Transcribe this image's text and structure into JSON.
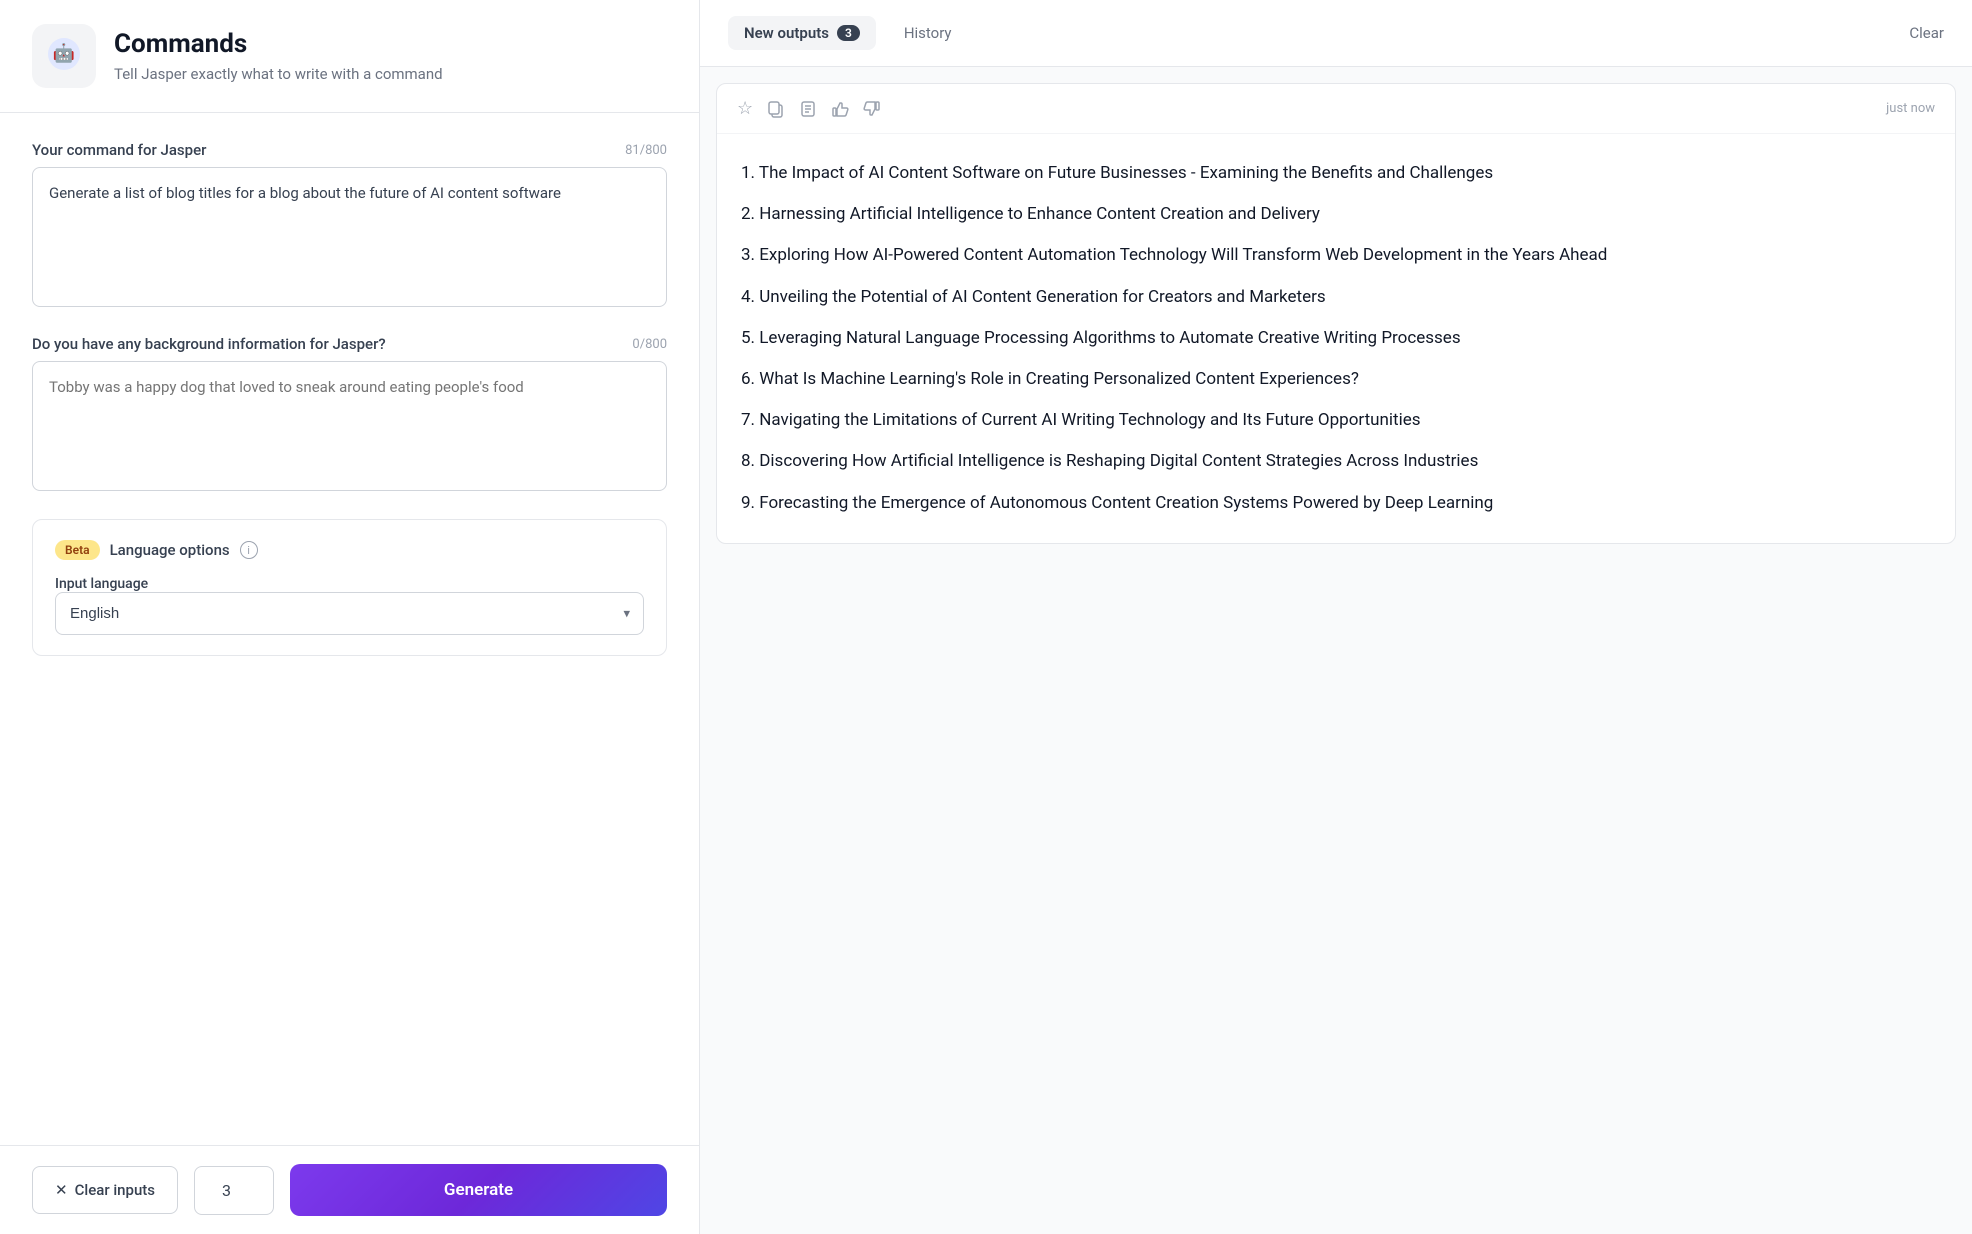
{
  "header": {
    "title": "Commands",
    "subtitle": "Tell Jasper exactly what to write with a command",
    "icon_label": "commands-icon"
  },
  "command_field": {
    "label": "Your command for Jasper",
    "char_count": "81/800",
    "value": "Generate a list of blog titles for a blog about the future of AI content software",
    "placeholder": ""
  },
  "background_field": {
    "label": "Do you have any background information for Jasper?",
    "char_count": "0/800",
    "value": "",
    "placeholder": "Tobby was a happy dog that loved to sneak around eating people's food"
  },
  "language_section": {
    "beta_label": "Beta",
    "title": "Language options",
    "input_lang_label": "Input language",
    "selected_language": "English"
  },
  "bottom_bar": {
    "clear_label": "Clear inputs",
    "count_value": "3",
    "generate_label": "Generate"
  },
  "right_panel": {
    "tab_new_outputs": "New outputs",
    "tab_badge": "3",
    "tab_history": "History",
    "clear_label": "Clear",
    "timestamp": "just now"
  },
  "output_items": [
    "1. The Impact of AI Content Software on Future Businesses - Examining the Benefits and Challenges",
    "2. Harnessing Artificial Intelligence to Enhance Content Creation and Delivery",
    "3. Exploring How AI-Powered Content Automation Technology Will Transform Web Development in the Years Ahead",
    "4. Unveiling the Potential of AI Content Generation for Creators and Marketers",
    "5. Leveraging Natural Language Processing Algorithms to Automate Creative Writing Processes",
    "6. What Is Machine Learning's Role in Creating Personalized Content Experiences?",
    "7. Navigating the Limitations of Current AI Writing Technology and Its Future Opportunities",
    "8. Discovering How Artificial Intelligence is Reshaping Digital Content Strategies Across Industries",
    "9. Forecasting the Emergence of Autonomous Content Creation Systems Powered by Deep Learning"
  ]
}
